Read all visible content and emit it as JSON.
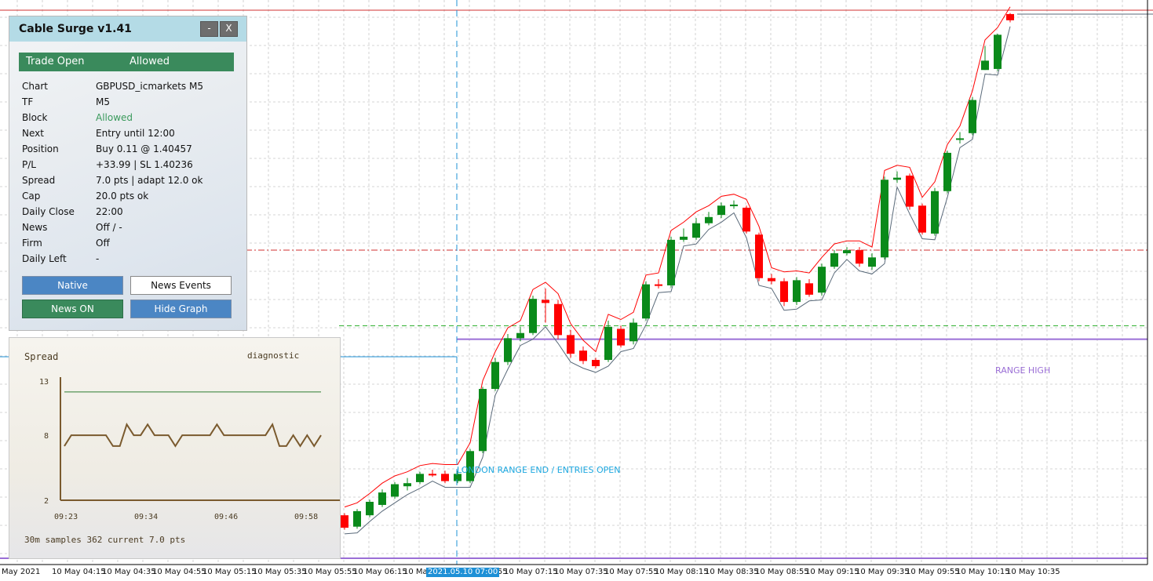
{
  "panel": {
    "title": "Cable Surge v1.41",
    "minimize_label": "-",
    "close_label": "X",
    "status_label": "Trade Open",
    "status_value": "Allowed",
    "rows": [
      {
        "label": "Chart",
        "value": "GBPUSD_icmarkets M5"
      },
      {
        "label": "TF",
        "value": "M5"
      },
      {
        "label": "Block",
        "value": "Allowed"
      },
      {
        "label": "Next",
        "value": "Entry until 12:00"
      },
      {
        "label": "Position",
        "value": "Buy 0.11 @ 1.40457"
      },
      {
        "label": "P/L",
        "value": "+33.99 | SL 1.40236"
      },
      {
        "label": "Spread",
        "value": "7.0 pts | adapt 12.0 ok"
      },
      {
        "label": "Cap",
        "value": "20.0 pts ok"
      },
      {
        "label": "Daily Close",
        "value": "22:00"
      },
      {
        "label": "News",
        "value": "Off / -"
      },
      {
        "label": "Firm",
        "value": "Off"
      },
      {
        "label": "Daily Left",
        "value": "-"
      }
    ],
    "buttons": {
      "native": "Native",
      "news_events": "News Events",
      "news_on": "News ON",
      "hide_graph": "Hide Graph"
    },
    "colors": {
      "header": "#b4dbe6",
      "green": "#3a8a5c",
      "blue": "#4b86c4",
      "allowed_text": "#3a9a5c"
    }
  },
  "spread_graph": {
    "title": "Spread",
    "mode": "diagnostic",
    "y_ticks": [
      "13",
      "8",
      "2"
    ],
    "x_ticks": [
      "09:23",
      "09:34",
      "09:46",
      "09:58"
    ],
    "footer": "30m samples 362   current 7.0 pts",
    "chart_data": {
      "type": "line",
      "ylim": [
        2,
        13
      ],
      "cap_line": 12.0,
      "values": [
        7.0,
        8.0,
        8.0,
        8.0,
        8.0,
        8.0,
        8.0,
        7.0,
        7.0,
        9.0,
        8.0,
        8.0,
        9.0,
        8.0,
        8.0,
        8.0,
        7.0,
        8.0,
        8.0,
        8.0,
        8.0,
        8.0,
        9.0,
        8.0,
        8.0,
        8.0,
        8.0,
        8.0,
        8.0,
        8.0,
        9.0,
        7.0,
        7.0,
        8.0,
        7.0,
        8.0,
        7.0,
        8.0
      ],
      "colors": {
        "line": "#7a5a2e",
        "cap": "#2e7d32",
        "axis": "#7a5a2e"
      }
    }
  },
  "chart": {
    "x_labels": [
      "May 2021",
      "10 May 04:15",
      "10 May 04:35",
      "10 May 04:55",
      "10 May 05:15",
      "10 May 05:35",
      "10 May 05:55",
      "10 May 06:15",
      "10 May 06:35",
      "10 May 06:55",
      "10 May 07:15",
      "10 May 07:35",
      "10 May 07:55",
      "10 May 08:15",
      "10 May 08:35",
      "10 May 08:55",
      "10 May 09:15",
      "10 May 09:35",
      "10 May 09:55",
      "10 May 10:15",
      "10 May 10:35"
    ],
    "crosshair_time": "2021.05.10 07:00",
    "range_high_label": "RANGE HIGH",
    "london_label": "LONDON RANGE END / ENTRIES OPEN",
    "colors": {
      "bull": "#0a8a1a",
      "bear": "#ff0000",
      "upper_band": "#ff0000",
      "lower_band": "#5a6a7a",
      "range": "#9b6fd6",
      "crosshair": "#1e90d6",
      "grid": "#c8c8c8"
    },
    "chart_data": {
      "type": "candlestick",
      "candles": [
        {
          "o": 40,
          "c": 28,
          "h": 42,
          "l": 26
        },
        {
          "o": 29,
          "c": 44,
          "h": 46,
          "l": 27
        },
        {
          "o": 40,
          "c": 53,
          "h": 55,
          "l": 38
        },
        {
          "o": 50,
          "c": 62,
          "h": 65,
          "l": 48
        },
        {
          "o": 58,
          "c": 70,
          "h": 72,
          "l": 56
        },
        {
          "o": 68,
          "c": 71,
          "h": 76,
          "l": 64
        },
        {
          "o": 72,
          "c": 80,
          "h": 82,
          "l": 70
        },
        {
          "o": 80,
          "c": 79,
          "h": 84,
          "l": 77
        },
        {
          "o": 80,
          "c": 73,
          "h": 83,
          "l": 71
        },
        {
          "o": 73,
          "c": 80,
          "h": 83,
          "l": 71
        },
        {
          "o": 73,
          "c": 102,
          "h": 104,
          "l": 71
        },
        {
          "o": 102,
          "c": 162,
          "h": 164,
          "l": 100
        },
        {
          "o": 162,
          "c": 188,
          "h": 192,
          "l": 160
        },
        {
          "o": 188,
          "c": 211,
          "h": 215,
          "l": 185
        },
        {
          "o": 211,
          "c": 216,
          "h": 222,
          "l": 208
        },
        {
          "o": 216,
          "c": 249,
          "h": 252,
          "l": 214
        },
        {
          "o": 248,
          "c": 245,
          "h": 259,
          "l": 226
        },
        {
          "o": 244,
          "c": 214,
          "h": 248,
          "l": 210
        },
        {
          "o": 214,
          "c": 196,
          "h": 219,
          "l": 192
        },
        {
          "o": 199,
          "c": 189,
          "h": 203,
          "l": 186
        },
        {
          "o": 190,
          "c": 184,
          "h": 192,
          "l": 182
        },
        {
          "o": 190,
          "c": 222,
          "h": 228,
          "l": 188
        },
        {
          "o": 220,
          "c": 204,
          "h": 223,
          "l": 202
        },
        {
          "o": 208,
          "c": 226,
          "h": 230,
          "l": 205
        },
        {
          "o": 230,
          "c": 263,
          "h": 266,
          "l": 228
        },
        {
          "o": 263,
          "c": 262,
          "h": 268,
          "l": 259
        },
        {
          "o": 262,
          "c": 306,
          "h": 309,
          "l": 260
        },
        {
          "o": 306,
          "c": 309,
          "h": 317,
          "l": 304
        },
        {
          "o": 308,
          "c": 322,
          "h": 327,
          "l": 306
        },
        {
          "o": 322,
          "c": 328,
          "h": 333,
          "l": 320
        },
        {
          "o": 330,
          "c": 339,
          "h": 342,
          "l": 327
        },
        {
          "o": 339,
          "c": 340,
          "h": 344,
          "l": 336
        },
        {
          "o": 337,
          "c": 314,
          "h": 339,
          "l": 312
        },
        {
          "o": 311,
          "c": 269,
          "h": 313,
          "l": 266
        },
        {
          "o": 269,
          "c": 266,
          "h": 273,
          "l": 263
        },
        {
          "o": 266,
          "c": 246,
          "h": 269,
          "l": 242
        },
        {
          "o": 246,
          "c": 267,
          "h": 270,
          "l": 243
        },
        {
          "o": 264,
          "c": 253,
          "h": 268,
          "l": 251
        },
        {
          "o": 255,
          "c": 280,
          "h": 283,
          "l": 252
        },
        {
          "o": 280,
          "c": 293,
          "h": 296,
          "l": 278
        },
        {
          "o": 293,
          "c": 296,
          "h": 299,
          "l": 291
        },
        {
          "o": 296,
          "c": 283,
          "h": 299,
          "l": 280
        },
        {
          "o": 280,
          "c": 289,
          "h": 293,
          "l": 277
        },
        {
          "o": 289,
          "c": 364,
          "h": 367,
          "l": 287
        },
        {
          "o": 364,
          "c": 366,
          "h": 372,
          "l": 361
        },
        {
          "o": 368,
          "c": 338,
          "h": 370,
          "l": 335
        },
        {
          "o": 339,
          "c": 313,
          "h": 341,
          "l": 311
        },
        {
          "o": 312,
          "c": 353,
          "h": 356,
          "l": 310
        },
        {
          "o": 353,
          "c": 390,
          "h": 392,
          "l": 351
        },
        {
          "o": 403,
          "c": 404,
          "h": 410,
          "l": 399
        },
        {
          "o": 409,
          "c": 441,
          "h": 444,
          "l": 407
        },
        {
          "o": 470,
          "c": 479,
          "h": 493,
          "l": 470
        },
        {
          "o": 471,
          "c": 504,
          "h": 505,
          "l": 469
        },
        {
          "o": 524,
          "c": 518,
          "h": 525,
          "l": 516
        }
      ],
      "range_high": 210,
      "range_low": 0,
      "dash_red_level": 296,
      "dash_green_level": 223,
      "ylim": [
        0,
        530
      ]
    }
  }
}
